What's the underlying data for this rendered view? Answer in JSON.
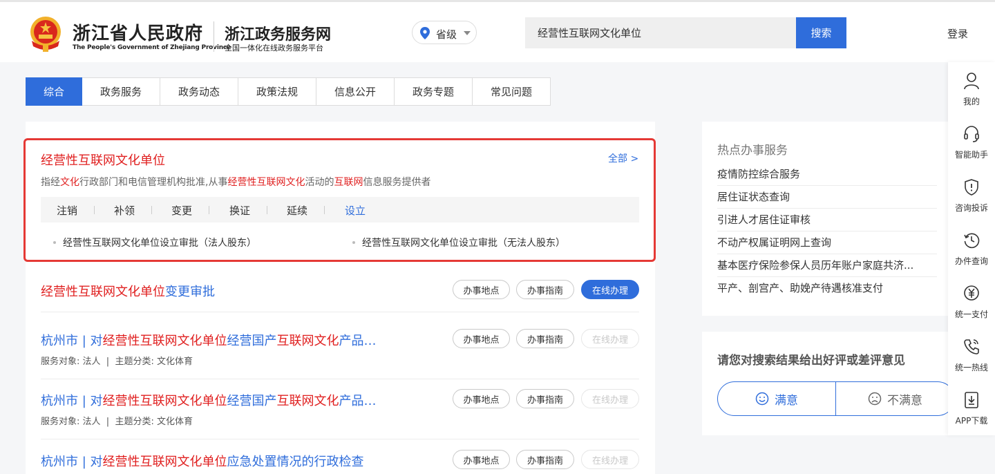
{
  "header": {
    "gov_name": "浙江省人民政府",
    "gov_name_en": "The People's Government of Zhejiang Province",
    "site_name": "浙江政务服务网",
    "site_subtitle": "全国一体化在线政务服务平台",
    "region": "省级",
    "search_value": "经营性互联网文化单位",
    "search_button": "搜索",
    "login": "登录"
  },
  "tabs": [
    {
      "label": "综合",
      "active": true
    },
    {
      "label": "政务服务"
    },
    {
      "label": "政务动态"
    },
    {
      "label": "政策法规"
    },
    {
      "label": "信息公开"
    },
    {
      "label": "政务专题"
    },
    {
      "label": "常见问题"
    }
  ],
  "featured": {
    "title": "经营性互联网文化单位",
    "all_link": "全部 >",
    "desc_parts": [
      "指经",
      "文化",
      "行政部门和电信管理机构批准,从事",
      "经营性互联网文化",
      "活动的",
      "互联网",
      "信息服务提供者"
    ],
    "subtabs": [
      "注销",
      "补领",
      "变更",
      "换证",
      "延续",
      "设立"
    ],
    "items": [
      "经营性互联网文化单位设立审批（法人股东）",
      "经营性互联网文化单位设立审批（无法人股东）"
    ]
  },
  "results": [
    {
      "title_red": "经营性互联网文化单位",
      "title_blue": "变更审批",
      "buttons": [
        "办事地点",
        "办事指南",
        "在线办理"
      ]
    },
    {
      "title_parts": [
        "杭州市 | 对",
        "经营性互联网文化单位",
        "经营国产",
        "互联网文化",
        "产品…"
      ],
      "meta_label1": "服务对象:",
      "meta_value1": "法人",
      "meta_label2": "主题分类:",
      "meta_value2": "文化体育",
      "buttons": [
        "办事地点",
        "办事指南",
        "在线办理"
      ]
    },
    {
      "title_parts": [
        "杭州市 | 对",
        "经营性互联网文化单位",
        "经营国产",
        "互联网文化",
        "产品…"
      ],
      "meta_label1": "服务对象:",
      "meta_value1": "法人",
      "meta_label2": "主题分类:",
      "meta_value2": "文化体育",
      "buttons": [
        "办事地点",
        "办事指南",
        "在线办理"
      ]
    },
    {
      "title_parts": [
        "杭州市 | 对",
        "经营性互联网文化单位",
        "应急处置情况的行政检查"
      ],
      "buttons": [
        "办事地点",
        "办事指南",
        "在线办理"
      ]
    }
  ],
  "hot": {
    "title": "热点办事服务",
    "items": [
      "疫情防控综合服务",
      "居住证状态查询",
      "引进人才居住证审核",
      "不动产权属证明网上查询",
      "基本医疗保险参保人员历年账户家庭共济...",
      "平产、剖宫产、助娩产待遇核准支付"
    ]
  },
  "feedback": {
    "title": "请您对搜索结果给出好评或差评意见",
    "satisfied": "满意",
    "unsatisfied": "不满意"
  },
  "sidebar": [
    {
      "label": "我的",
      "icon": "user-icon"
    },
    {
      "label": "智能助手",
      "icon": "headset-icon"
    },
    {
      "label": "咨询投诉",
      "icon": "shield-alert-icon"
    },
    {
      "label": "办件查询",
      "icon": "history-clock-icon"
    },
    {
      "label": "统一支付",
      "icon": "yen-icon"
    },
    {
      "label": "统一热线",
      "icon": "phone-icon"
    },
    {
      "label": "APP下载",
      "icon": "download-icon"
    }
  ],
  "colors": {
    "accent": "#2f6ddb",
    "highlight": "#e02020",
    "frame": "#e53935"
  }
}
